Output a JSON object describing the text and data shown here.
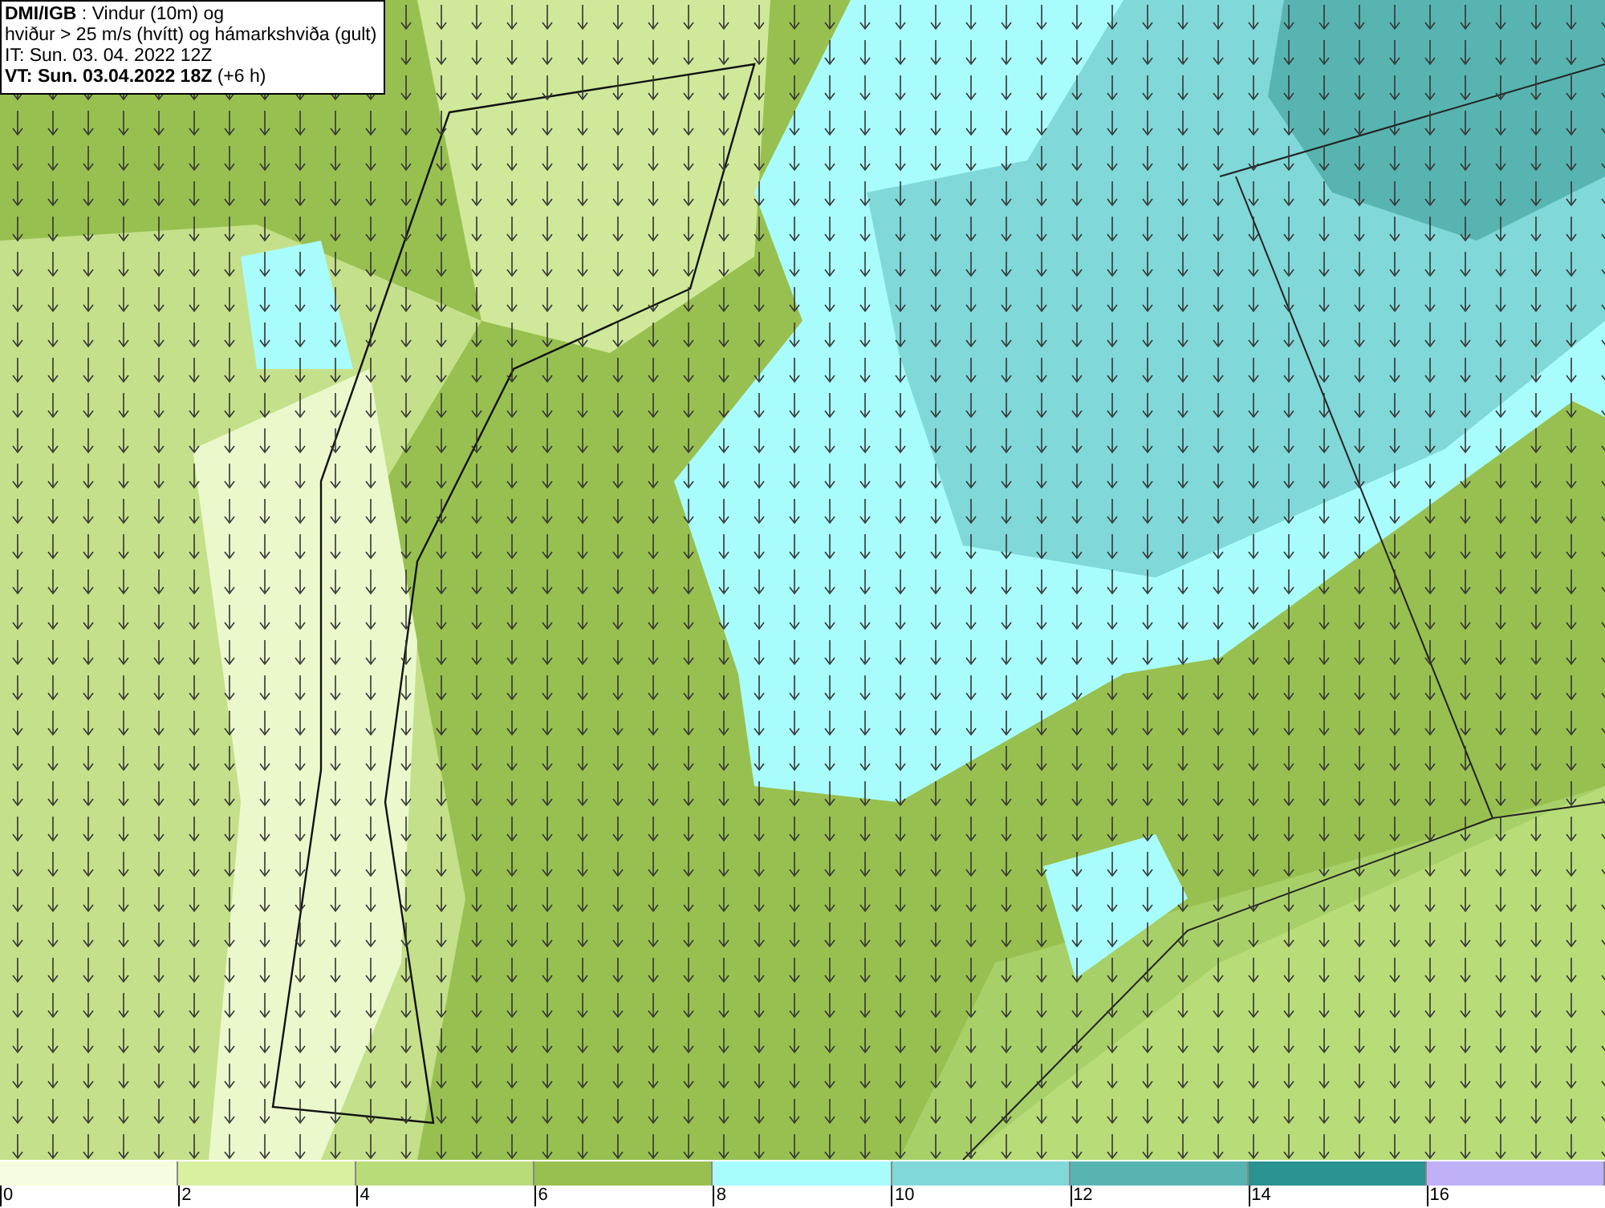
{
  "info_box": {
    "lines": [
      "**DMI/IGB** : Vindur (10m) og",
      "hviður > 25 m/s (hvítt) og hámarkshviða (gult)",
      "IT: Sun. 03. 04. 2022 12Z",
      "**VT: Sun. 03.04.2022 18Z** (+6 h)"
    ]
  },
  "legend": {
    "bins": [
      {
        "color": "#f5fce0"
      },
      {
        "color": "#d8f0a0"
      },
      {
        "color": "#b8dc78"
      },
      {
        "color": "#98c050"
      },
      {
        "color": "#a8fcfc"
      },
      {
        "color": "#80d8d8"
      },
      {
        "color": "#58b4b0"
      },
      {
        "color": "#2a9290"
      },
      {
        "color": "#c0b0f8"
      }
    ],
    "labels": [
      "0",
      "2",
      "4",
      "6",
      "8",
      "10",
      "12",
      "14",
      "16"
    ]
  }
}
